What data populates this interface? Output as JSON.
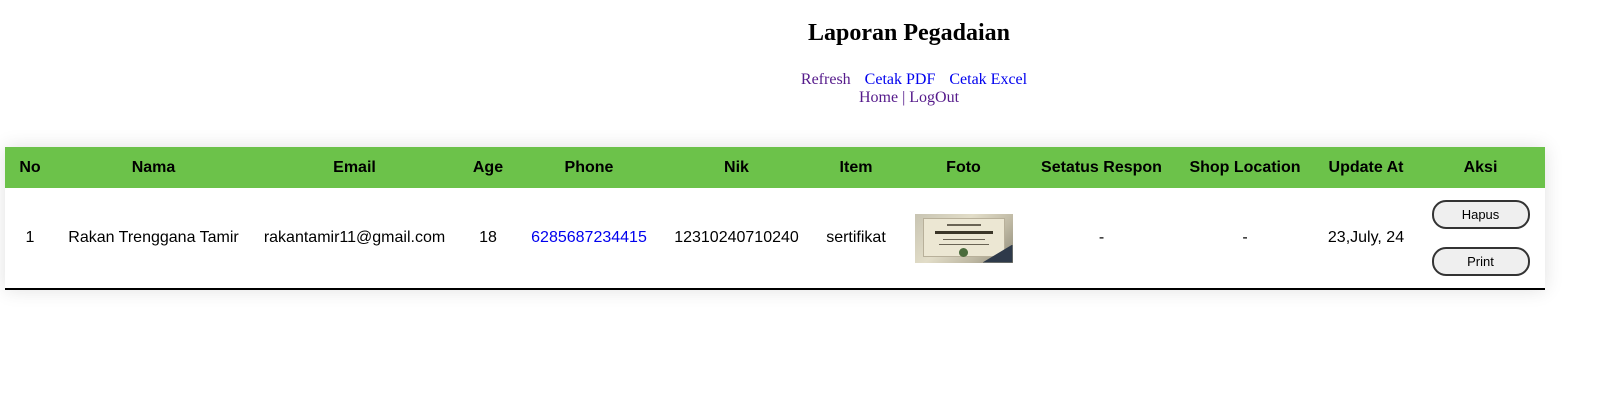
{
  "page": {
    "title": "Laporan Pegadaian"
  },
  "actions": {
    "refresh": "Refresh",
    "cetak_pdf": "Cetak PDF",
    "cetak_excel": "Cetak Excel"
  },
  "nav": {
    "home": "Home",
    "separator": "|",
    "logout": "LogOut"
  },
  "table": {
    "header_color": "#6cc24a",
    "columns": [
      "No",
      "Nama",
      "Email",
      "Age",
      "Phone",
      "Nik",
      "Item",
      "Foto",
      "Setatus Respon",
      "Shop Location",
      "Update At",
      "Aksi"
    ],
    "rows": [
      {
        "no": "1",
        "nama": "Rakan Trenggana Tamir",
        "email": "rakantamir11@gmail.com",
        "age": "18",
        "phone": "6285687234415",
        "nik": "12310240710240",
        "item": "sertifikat",
        "foto": "certificate-photo-thumbnail",
        "status": "-",
        "shop_location": "-",
        "update_at": "23,July, 24",
        "buttons": {
          "hapus": "Hapus",
          "print": "Print"
        }
      }
    ]
  }
}
